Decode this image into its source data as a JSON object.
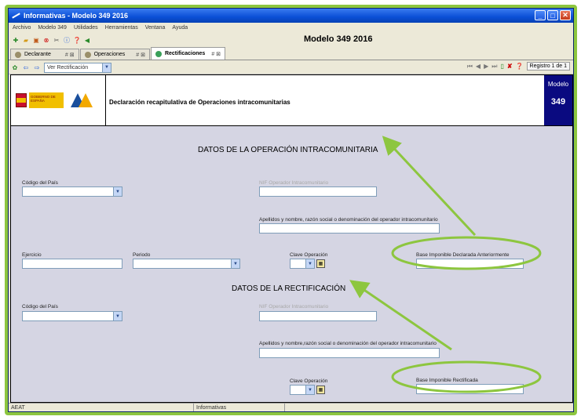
{
  "window": {
    "title": "Informativas - Modelo 349 2016"
  },
  "menu": [
    "Archivo",
    "Modelo 349",
    "Utilidades",
    "Herramientas",
    "Ventana",
    "Ayuda"
  ],
  "toolbar": {
    "doc_title": "Modelo 349 2016"
  },
  "tabs": [
    {
      "label": "Declarante",
      "marks": "# ⊠"
    },
    {
      "label": "Operaciones",
      "marks": "# ⊠"
    },
    {
      "label": "Rectificaciones",
      "marks": "# ⊠"
    }
  ],
  "navbar": {
    "view_select": "Ver Rectificación",
    "registro": "Registro 1 de 1"
  },
  "header": {
    "gob_text": "GOBIERNO DE ESPAÑA",
    "description": "Declaración recapitulativa de Operaciones intracomunitarias",
    "modelo_label": "Modelo",
    "modelo_number": "349"
  },
  "section1": {
    "title": "DATOS DE LA OPERACIÓN INTRACOMUNITARIA",
    "codigo_pais_label": "Código del País",
    "nif_label": "NIF Operador Intracomunitario",
    "apellidos_label": "Apellidos y nombre, razón social o denominación del operador intracomunitario",
    "ejercicio_label": "Ejercicio",
    "periodo_label": "Periodo",
    "clave_label": "Clave Operación",
    "base_label": "Base Imponible Declarada Anteriormente"
  },
  "section2": {
    "title": "DATOS DE LA RECTIFICACIÓN",
    "codigo_pais_label": "Código del País",
    "nif_label": "NIF Operador Intracomunitario",
    "apellidos_label": "Apellidos y nombre,razón social o denominación del operador intracomunitario",
    "clave_label": "Clave Operación",
    "base_label": "Base Imponible Rectificada"
  },
  "status": {
    "left": "AEAT",
    "middle": "Informativas",
    "right": ""
  },
  "colors": {
    "highlight": "#8dc63f",
    "title_bar": "#0a4fd6",
    "form_bg": "#d5d5e3",
    "modelo_bg": "#0a0a80"
  }
}
